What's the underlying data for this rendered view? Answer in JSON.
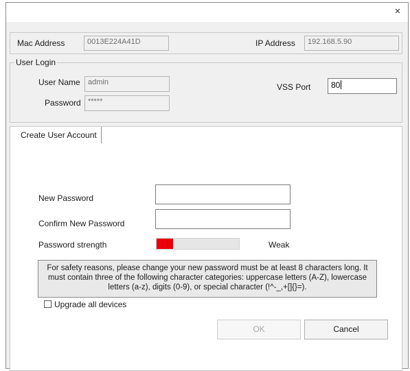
{
  "window": {
    "close_glyph": "×"
  },
  "device": {
    "mac_label": "Mac Address",
    "mac_value": "0013E224A41D",
    "ip_label": "IP Address",
    "ip_value": "192.168.5.90"
  },
  "login": {
    "legend": "User Login",
    "username_label": "User Name",
    "username_value": "admin",
    "password_label": "Password",
    "password_value": "*****",
    "vss_port_label": "VSS Port",
    "vss_port_value": "80"
  },
  "tab": {
    "label": "Create User Account"
  },
  "form": {
    "new_password_label": "New Password",
    "confirm_password_label": "Confirm New Password",
    "strength_label": "Password strength",
    "strength_text": "Weak",
    "strength_level": 0.2,
    "strength_color": "#e8000b",
    "notice": "For safety reasons, please change your new password must be at least 8 characters long. It must contain three of the following character categories: uppercase letters (A-Z), lowercase letters (a-z), digits (0-9), or special character (!^-_,+[]{}=).",
    "upgrade_label": "Upgrade all devices",
    "upgrade_checked": false
  },
  "buttons": {
    "ok": "OK",
    "cancel": "Cancel"
  }
}
